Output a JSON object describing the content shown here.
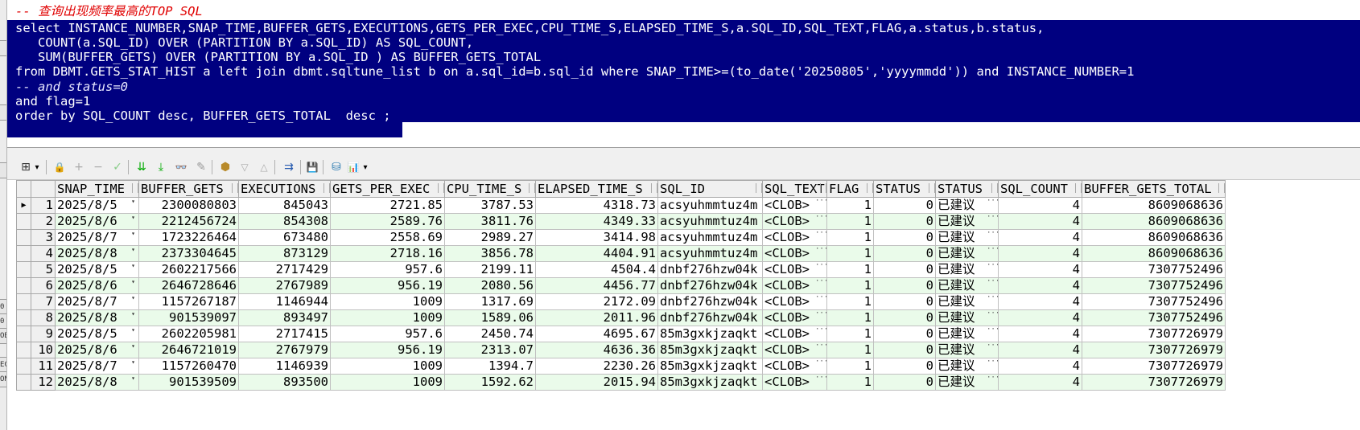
{
  "editor": {
    "lines": [
      "-- 查询出现频率最高的TOP SQL",
      "select INSTANCE_NUMBER,SNAP_TIME,BUFFER_GETS,EXECUTIONS,GETS_PER_EXEC,CPU_TIME_S,ELAPSED_TIME_S,a.SQL_ID,SQL_TEXT,FLAG,a.status,b.status,",
      "   COUNT(a.SQL_ID) OVER (PARTITION BY a.SQL_ID) AS SQL_COUNT,",
      "   SUM(BUFFER_GETS) OVER (PARTITION BY a.SQL_ID ) AS BUFFER_GETS_TOTAL",
      "from DBMT.GETS_STAT_HIST a left join dbmt.sqltune_list b on a.sql_id=b.sql_id where SNAP_TIME>=(to_date('20250805','yyyymmdd')) and INSTANCE_NUMBER=1",
      "-- and status=0",
      "and flag=1",
      "order by SQL_COUNT desc, BUFFER_GETS_TOTAL  desc ;"
    ]
  },
  "left_marks": [
    "0",
    "0",
    "OB",
    "EC",
    "ON"
  ],
  "toolbar": {
    "icons": [
      "grid-icon",
      "dropdown-icon",
      "lock-icon",
      "add-icon",
      "remove-icon",
      "check-icon",
      "first-record-icon",
      "last-record-icon",
      "find-icon",
      "clear-icon",
      "query-icon",
      "down-icon",
      "up-icon",
      "connect-icon",
      "save-icon",
      "export-icon",
      "chart-icon",
      "chart-dropdown-icon"
    ],
    "glyphs": {
      "grid": "⊞",
      "drop": "▾",
      "lock": "🔒",
      "add": "+",
      "remove": "−",
      "check": "✓",
      "first": "⇊",
      "last": "⤓",
      "find": "👓",
      "clear": "✎",
      "query": "⬢",
      "down": "▽",
      "up": "△",
      "connect": "⇉",
      "save": "💾",
      "export": "⛁",
      "chart": "📊"
    }
  },
  "grid": {
    "columns": [
      "SNAP_TIME",
      "BUFFER_GETS",
      "EXECUTIONS",
      "GETS_PER_EXEC",
      "CPU_TIME_S",
      "ELAPSED_TIME_S",
      "SQL_ID",
      "SQL_TEXT",
      "FLAG",
      "STATUS",
      "STATUS",
      "SQL_COUNT",
      "BUFFER_GETS_TOTAL"
    ],
    "row_indicator": "▶",
    "rows": [
      [
        "1",
        "2025/8/5",
        "2300080803",
        "845043",
        "2721.85",
        "3787.53",
        "4318.73",
        "acsyuhmmtuz4m",
        "<CLOB>",
        "1",
        "0",
        "已建议",
        "4",
        "8609068636"
      ],
      [
        "2",
        "2025/8/6",
        "2212456724",
        "854308",
        "2589.76",
        "3811.76",
        "4349.33",
        "acsyuhmmtuz4m",
        "<CLOB>",
        "1",
        "0",
        "已建议",
        "4",
        "8609068636"
      ],
      [
        "3",
        "2025/8/7",
        "1723226464",
        "673480",
        "2558.69",
        "2989.27",
        "3414.98",
        "acsyuhmmtuz4m",
        "<CLOB>",
        "1",
        "0",
        "已建议",
        "4",
        "8609068636"
      ],
      [
        "4",
        "2025/8/8",
        "2373304645",
        "873129",
        "2718.16",
        "3856.78",
        "4404.91",
        "acsyuhmmtuz4m",
        "<CLOB>",
        "1",
        "0",
        "已建议",
        "4",
        "8609068636"
      ],
      [
        "5",
        "2025/8/5",
        "2602217566",
        "2717429",
        "957.6",
        "2199.11",
        "4504.4",
        "dnbf276hzw04k",
        "<CLOB>",
        "1",
        "0",
        "已建议",
        "4",
        "7307752496"
      ],
      [
        "6",
        "2025/8/6",
        "2646728646",
        "2767989",
        "956.19",
        "2080.56",
        "4456.77",
        "dnbf276hzw04k",
        "<CLOB>",
        "1",
        "0",
        "已建议",
        "4",
        "7307752496"
      ],
      [
        "7",
        "2025/8/7",
        "1157267187",
        "1146944",
        "1009",
        "1317.69",
        "2172.09",
        "dnbf276hzw04k",
        "<CLOB>",
        "1",
        "0",
        "已建议",
        "4",
        "7307752496"
      ],
      [
        "8",
        "2025/8/8",
        "901539097",
        "893497",
        "1009",
        "1589.06",
        "2011.96",
        "dnbf276hzw04k",
        "<CLOB>",
        "1",
        "0",
        "已建议",
        "4",
        "7307752496"
      ],
      [
        "9",
        "2025/8/5",
        "2602205981",
        "2717415",
        "957.6",
        "2450.74",
        "4695.67",
        "85m3gxkjzaqkt",
        "<CLOB>",
        "1",
        "0",
        "已建议",
        "4",
        "7307726979"
      ],
      [
        "10",
        "2025/8/6",
        "2646721019",
        "2767979",
        "956.19",
        "2313.07",
        "4636.36",
        "85m3gxkjzaqkt",
        "<CLOB>",
        "1",
        "0",
        "已建议",
        "4",
        "7307726979"
      ],
      [
        "11",
        "2025/8/7",
        "1157260470",
        "1146939",
        "1009",
        "1394.7",
        "2230.26",
        "85m3gxkjzaqkt",
        "<CLOB>",
        "1",
        "0",
        "已建议",
        "4",
        "7307726979"
      ],
      [
        "12",
        "2025/8/8",
        "901539509",
        "893500",
        "1009",
        "1592.62",
        "2015.94",
        "85m3gxkjzaqkt",
        "<CLOB>",
        "1",
        "0",
        "已建议",
        "4",
        "7307726979"
      ]
    ]
  }
}
